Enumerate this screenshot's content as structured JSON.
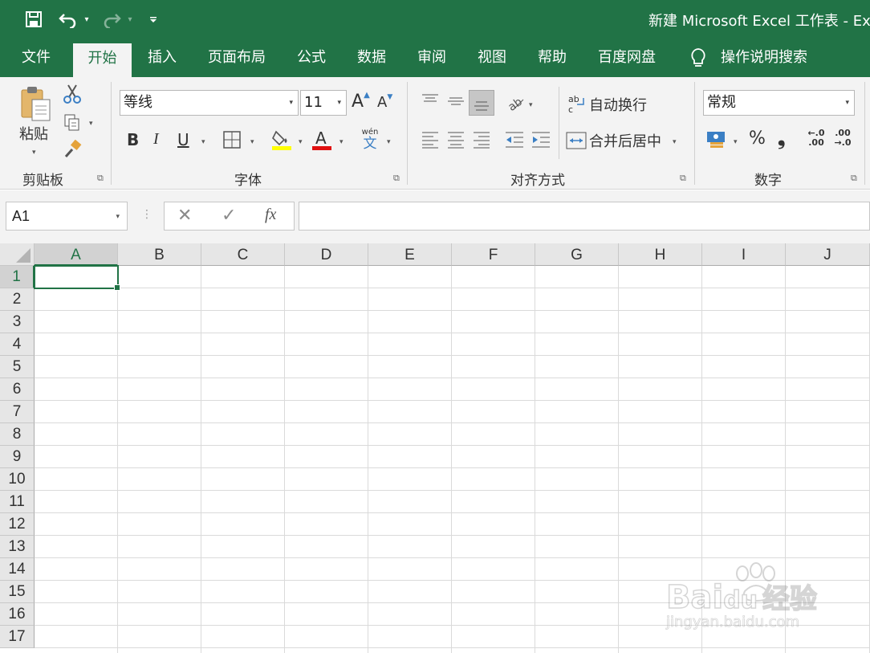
{
  "title_bar": {
    "title": "新建 Microsoft Excel 工作表  -  Ex",
    "qat": {
      "save": "save-icon",
      "undo": "undo-icon",
      "redo": "redo-icon",
      "customize": "customize-qat-icon"
    }
  },
  "tabs": [
    "文件",
    "开始",
    "插入",
    "页面布局",
    "公式",
    "数据",
    "审阅",
    "视图",
    "帮助",
    "百度网盘",
    "操作说明搜索"
  ],
  "active_tab": "开始",
  "ribbon": {
    "clipboard": {
      "label": "剪贴板",
      "paste": "粘贴"
    },
    "font": {
      "label": "字体",
      "font_name": "等线",
      "font_size": "11",
      "bold": "B",
      "italic": "I",
      "underline": "U",
      "grow": "A",
      "shrink": "A",
      "phonetic_top": "wén",
      "phonetic_bottom": "文"
    },
    "alignment": {
      "label": "对齐方式",
      "wrap_text": "自动换行",
      "merge_center": "合并后居中",
      "wrap_icon_text": "ab"
    },
    "number": {
      "label": "数字",
      "format": "常规",
      "percent": "%",
      "comma": "❟",
      "inc_decimal_top": "←.0",
      "inc_decimal_bottom": ".00",
      "dec_decimal_top": ".00",
      "dec_decimal_bottom": "→.0"
    }
  },
  "formula_bar": {
    "name_box": "A1",
    "cancel": "✕",
    "enter": "✓",
    "fx": "fx",
    "value": ""
  },
  "columns": [
    "A",
    "B",
    "C",
    "D",
    "E",
    "F",
    "G",
    "H",
    "I",
    "J"
  ],
  "rows": [
    "1",
    "2",
    "3",
    "4",
    "5",
    "6",
    "7",
    "8",
    "9",
    "10",
    "11",
    "12",
    "13",
    "14",
    "15",
    "16",
    "17"
  ],
  "selected_cell": "A1",
  "watermark": {
    "brand": "Bai",
    "brand_suffix": "du",
    "product": "经验",
    "url": "jingyan.baidu.com"
  },
  "colors": {
    "accent": "#217346",
    "ribbon_bg": "#f3f3f3",
    "header_bg": "#e6e6e6",
    "gridline": "#dadada"
  }
}
